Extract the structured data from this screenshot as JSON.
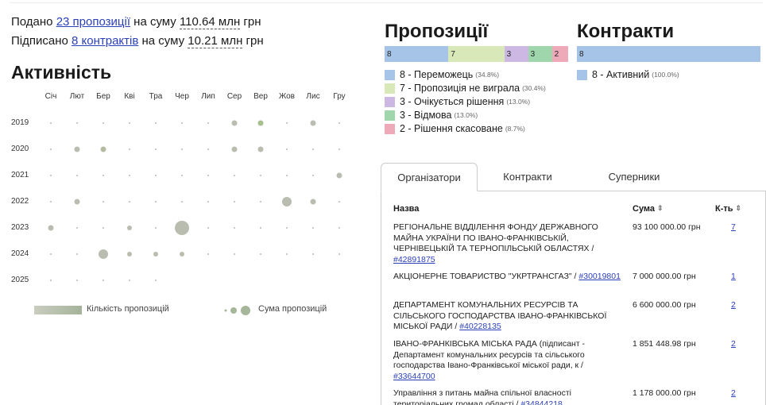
{
  "summary": {
    "line1_prefix": "Подано",
    "line1_link": "23 пропозиції",
    "line1_mid": "на суму",
    "line1_amount": "110.64 млн",
    "line1_suffix": "грн",
    "line2_prefix": "Підписано",
    "line2_link": "8 контрактів",
    "line2_mid": "на суму",
    "line2_amount": "10.21 млн",
    "line2_suffix": "грн"
  },
  "activity": {
    "title": "Активність",
    "months": [
      "Січ",
      "Лют",
      "Бер",
      "Кві",
      "Тра",
      "Чер",
      "Лип",
      "Сер",
      "Вер",
      "Жов",
      "Лис",
      "Гру"
    ],
    "years": [
      "2019",
      "2020",
      "2021",
      "2022",
      "2023",
      "2024",
      "2025"
    ],
    "bubbles": [
      {
        "year": "2019",
        "month": 8,
        "size": 2,
        "color": "#b9bdb0"
      },
      {
        "year": "2019",
        "month": 9,
        "size": 2,
        "color": "#a6c08f"
      },
      {
        "year": "2019",
        "month": 11,
        "size": 2,
        "color": "#b9bdb0"
      },
      {
        "year": "2020",
        "month": 2,
        "size": 2,
        "color": "#b9bdb0"
      },
      {
        "year": "2020",
        "month": 3,
        "size": 2,
        "color": "#b5bca2"
      },
      {
        "year": "2020",
        "month": 8,
        "size": 2,
        "color": "#b9bdb0"
      },
      {
        "year": "2020",
        "month": 9,
        "size": 2,
        "color": "#b9bdb0"
      },
      {
        "year": "2021",
        "month": 12,
        "size": 2,
        "color": "#b9bdb0"
      },
      {
        "year": "2022",
        "month": 2,
        "size": 2,
        "color": "#b9bdb0"
      },
      {
        "year": "2022",
        "month": 10,
        "size": 3,
        "color": "#b9bdb0"
      },
      {
        "year": "2022",
        "month": 11,
        "size": 2,
        "color": "#b9bdb0"
      },
      {
        "year": "2023",
        "month": 1,
        "size": 2,
        "color": "#b9bdb0"
      },
      {
        "year": "2023",
        "month": 4,
        "size": 1,
        "color": "#b9bdb0"
      },
      {
        "year": "2023",
        "month": 6,
        "size": 5,
        "color": "#b9bdb0"
      },
      {
        "year": "2024",
        "month": 3,
        "size": 3,
        "color": "#b9bdb0"
      },
      {
        "year": "2024",
        "month": 4,
        "size": 1,
        "color": "#b9bdb0"
      },
      {
        "year": "2024",
        "month": 5,
        "size": 1,
        "color": "#b9bdb0"
      },
      {
        "year": "2024",
        "month": 6,
        "size": 1,
        "color": "#b9bdb0"
      }
    ],
    "empty_2025_after_month": 5,
    "legend_count": "Кількість пропозицій",
    "legend_sum": "Сума пропозицій"
  },
  "proposals": {
    "title": "Пропозиції",
    "segments": [
      {
        "label": "8",
        "pct": 34.8,
        "color": "#a6c4e7"
      },
      {
        "label": "7",
        "pct": 30.4,
        "color": "#d9e8b8"
      },
      {
        "label": "3",
        "pct": 13.0,
        "color": "#cdb7e3"
      },
      {
        "label": "3",
        "pct": 13.0,
        "color": "#9fd6ac"
      },
      {
        "label": "2",
        "pct": 8.7,
        "color": "#eeaab8"
      }
    ],
    "legend": [
      {
        "text": "8 - Переможець",
        "pct": "(34.8%)"
      },
      {
        "text": "7 - Пропозиція не виграла",
        "pct": "(30.4%)"
      },
      {
        "text": "3 - Очікується рішення",
        "pct": "(13.0%)"
      },
      {
        "text": "3 - Відмова",
        "pct": "(13.0%)"
      },
      {
        "text": "2 - Рішення скасоване",
        "pct": "(8.7%)"
      }
    ]
  },
  "contracts": {
    "title": "Контракти",
    "segments": [
      {
        "label": "8",
        "pct": 100,
        "color": "#a6c4e7"
      }
    ],
    "legend": [
      {
        "text": "8 - Активний",
        "pct": "(100.0%)"
      }
    ]
  },
  "tabs": [
    "Організатори",
    "Контракти",
    "Суперники"
  ],
  "table": {
    "col_name": "Назва",
    "col_sum": "Сума",
    "col_count": "К-ть",
    "rows": [
      {
        "name": "РЕГІОНАЛЬНЕ ВІДДІЛЕННЯ ФОНДУ ДЕРЖАВНОГО МАЙНА УКРАЇНИ ПО ІВАНО-ФРАНКІВСЬКІЙ, ЧЕРНІВЕЦЬКІЙ ТА ТЕРНОПІЛЬСЬКІЙ ОБЛАСТЯХ / ",
        "code": "#42891875",
        "sum": "93 100 000.00 грн",
        "count": "7"
      },
      {
        "name": "АКЦІОНЕРНЕ ТОВАРИСТВО \"УКРТРАНСГАЗ\" / ",
        "code": "#30019801",
        "sum": "7 000 000.00 грн",
        "count": "1"
      },
      {
        "name": "ДЕПАРТАМЕНТ КОМУНАЛЬНИХ РЕСУРСІВ ТА СІЛЬСЬКОГО ГОСПОДАРСТВА ІВАНО-ФРАНКІВСЬКОЇ МІСЬКОЇ РАДИ / ",
        "code": "#40228135",
        "sum": "6 600 000.00 грн",
        "count": "2"
      },
      {
        "name": "ІВАНО-ФРАНКІВСЬКА МІСЬКА РАДА (підписант - Департамент комунальних ресурсів та сільського господарства Івано-Франківської міської ради, к / ",
        "code": "#33644700",
        "sum": "1 851 448.98 грн",
        "count": "2"
      },
      {
        "name": "Управління з питань майна спільної власності територіальних громад області / ",
        "code": "#34844218",
        "sum": "1 178 000.00 грн",
        "count": "2"
      }
    ]
  }
}
